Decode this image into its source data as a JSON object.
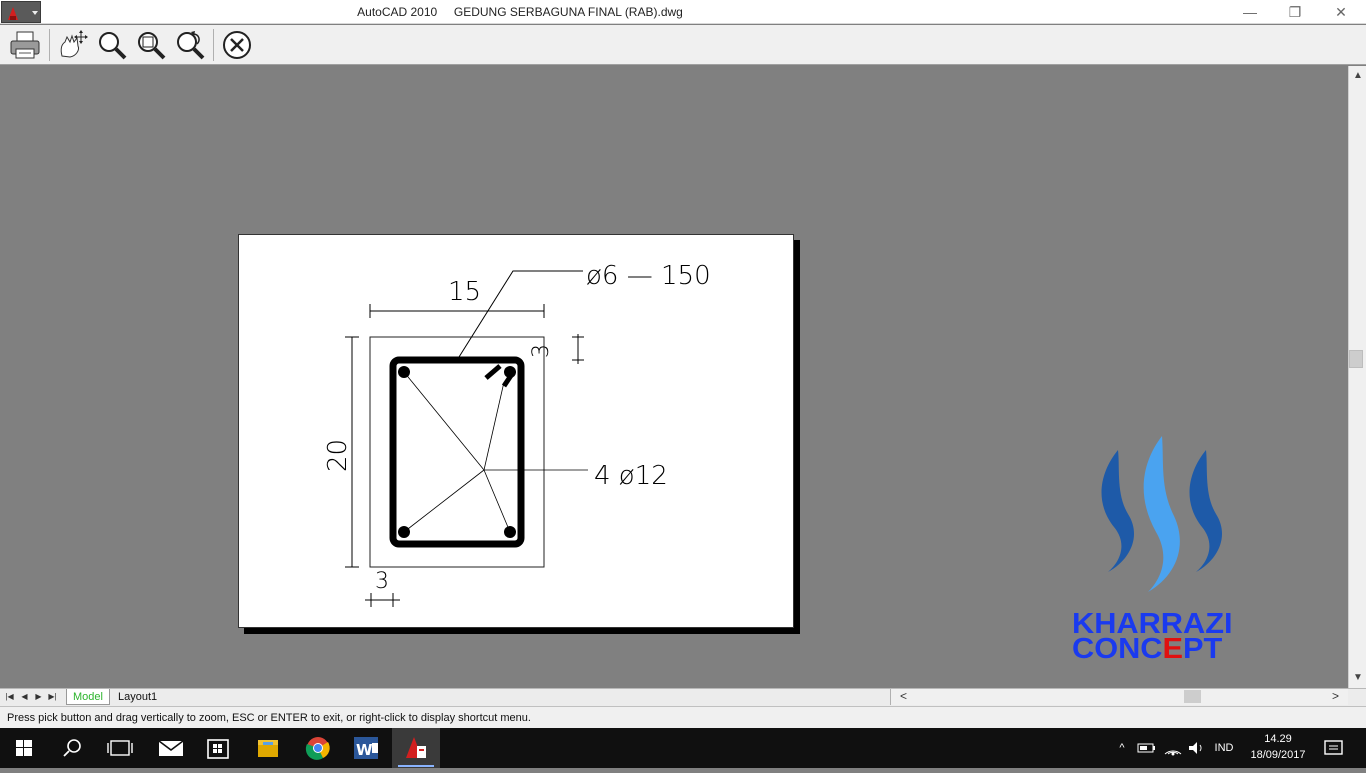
{
  "window": {
    "app_name": "AutoCAD 2010",
    "file_name": "GEDUNG SERBAGUNA FINAL (RAB).dwg",
    "minimize_glyph": "—",
    "restore_glyph": "❐",
    "close_glyph": "✕"
  },
  "toolbar": {
    "icons": [
      "printer-icon",
      "pan-icon",
      "zoom-icon",
      "zoom-window-icon",
      "zoom-previous-icon",
      "close-icon"
    ]
  },
  "drawing": {
    "dim_width": "15",
    "dim_height": "20",
    "dim_cover_top": "3",
    "dim_cover_bottom": "3",
    "stirrup_label": "ø6 — 150",
    "rebar_label": "4 ø12"
  },
  "tabs": {
    "model": "Model",
    "layout1": "Layout1"
  },
  "command_line": {
    "prompt": "Press pick button and drag vertically to zoom, ESC or ENTER to exit, or right-click to display shortcut menu."
  },
  "watermark": {
    "line1": "KHARRAZI",
    "line2_a": "CONC",
    "line2_b": "E",
    "line2_c": "PT",
    "colors": {
      "blue_dark": "#1e5aa8",
      "blue_light": "#4aa3f0",
      "text_blue": "#1a3aef",
      "text_red": "#e01010"
    }
  },
  "taskbar": {
    "language": "IND",
    "time": "14.29",
    "date": "18/09/2017",
    "apps": [
      "start-icon",
      "search-icon",
      "task-view-icon",
      "mail-icon",
      "store-icon",
      "file-explorer-icon",
      "chrome-icon",
      "word-icon",
      "autocad-icon"
    ]
  }
}
